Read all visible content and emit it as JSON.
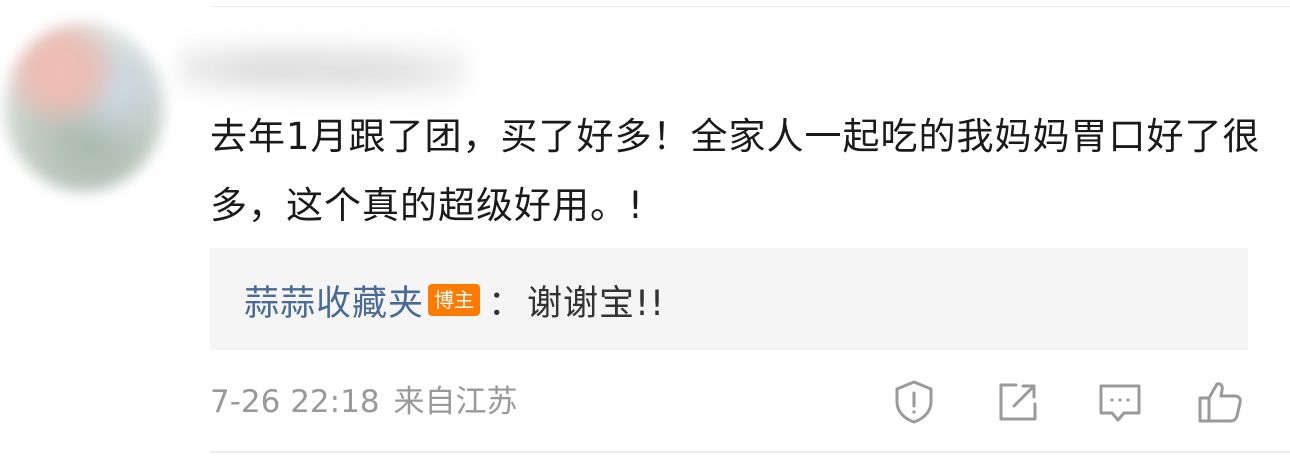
{
  "comment": {
    "text": "去年1月跟了团，买了好多！全家人一起吃的我妈妈胃口好了很多，这个真的超级好用。!"
  },
  "reply": {
    "author": "蒜蒜收藏夹",
    "badge": "博主",
    "separator": "：",
    "text": "谢谢宝!!"
  },
  "meta": {
    "timestamp": "7-26 22:18",
    "location": "来自江苏"
  },
  "actions": [
    {
      "icon": "report-icon"
    },
    {
      "icon": "share-icon"
    },
    {
      "icon": "comment-icon"
    },
    {
      "icon": "like-icon"
    }
  ],
  "colors": {
    "reply_author": "#4a6a93",
    "badge_bg": "#ff7a00",
    "meta_text": "#999999",
    "reply_bg": "#f5f5f5",
    "icon_stroke": "#9a9a9a"
  }
}
